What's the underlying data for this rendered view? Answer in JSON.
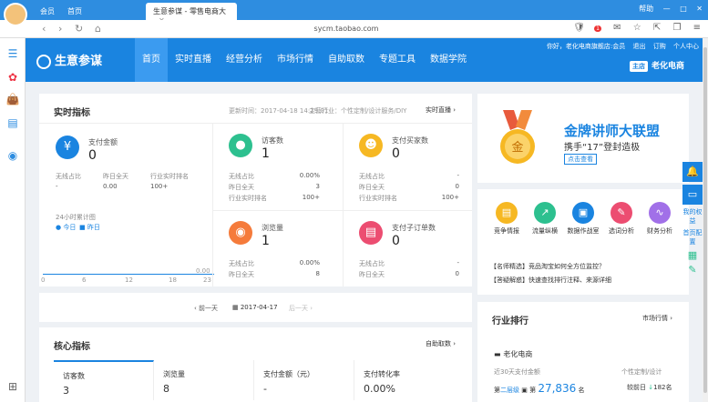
{
  "browser": {
    "tabs": [
      {
        "label": "会员"
      },
      {
        "label": "首页"
      },
      {
        "label": "生意参谋 - 零售电商大"
      }
    ],
    "right": [
      "帮助",
      "—",
      "□",
      "✕"
    ],
    "url": "sycm.taobao.com",
    "notif_count": "1"
  },
  "header": {
    "logo": "生意参谋",
    "menu": [
      "首页",
      "实时直播",
      "经营分析",
      "市场行情",
      "自助取数",
      "专题工具",
      "数据学院"
    ],
    "top_links": [
      "你好，老化电商旗舰店:会员",
      "退出",
      "订购",
      "个人中心"
    ],
    "store_tag": "主店",
    "store_name": "老化电商"
  },
  "realtime": {
    "title": "实时指标",
    "update_time": "更新时间：2017-04-18 14:29:01",
    "industry": "主营行业：个性定制/设计服务/DIY",
    "link": "实时直播",
    "metrics": [
      {
        "label": "支付金额",
        "value": "0",
        "subs": [
          [
            "无线占比",
            "-"
          ],
          [
            "昨日全天",
            "0.00"
          ],
          [
            "行业实时排名",
            "100+"
          ]
        ]
      },
      {
        "label": "访客数",
        "value": "1",
        "subs": [
          [
            "无线占比",
            "0.00%"
          ],
          [
            "昨日全天",
            "3"
          ],
          [
            "行业实时排名",
            "100+"
          ]
        ]
      },
      {
        "label": "支付买家数",
        "value": "0",
        "subs": [
          [
            "无线占比",
            "-"
          ],
          [
            "昨日全天",
            "0"
          ],
          [
            "行业实时排名",
            "100+"
          ]
        ]
      },
      {
        "label": "浏览量",
        "value": "1",
        "subs": [
          [
            "无线占比",
            "0.00%"
          ],
          [
            "昨日全天",
            "8"
          ]
        ]
      },
      {
        "label": "支付子订单数",
        "value": "0",
        "subs": [
          [
            "无线占比",
            "-"
          ],
          [
            "昨日全天",
            "0"
          ]
        ]
      }
    ],
    "chart_label": "24小时累计图",
    "legend_today": "今日",
    "legend_yesterday": "昨日",
    "x_ticks": [
      "0",
      "6",
      "12",
      "18",
      "23"
    ],
    "y_tick": "0.00",
    "prev_day": "前一天",
    "date": "2017-04-17",
    "next_day": "后一天"
  },
  "banner": {
    "title": "金牌讲师大联盟",
    "subtitle": "携手“17”登封造极",
    "button": "点击查看"
  },
  "tools": {
    "items": [
      "竞争情报",
      "流量纵横",
      "数据作战室",
      "选词分析",
      "财务分析"
    ],
    "news": [
      {
        "tag": "【名师精选】",
        "text": "竞品淘宝如何全方位监控？"
      },
      {
        "tag": "【答疑解惑】",
        "text": "快速查找排行注释、来源详细"
      }
    ]
  },
  "core": {
    "title": "核心指标",
    "link": "自助取数",
    "tabs": [
      {
        "label": "访客数",
        "value": "3"
      },
      {
        "label": "浏览量",
        "value": "8"
      },
      {
        "label": "支付金额（元）",
        "value": "-"
      },
      {
        "label": "支付转化率",
        "value": "0.00%"
      }
    ]
  },
  "ranking": {
    "title": "行业排行",
    "link": "市场行情",
    "store": "老化电商",
    "period": "近30天支付金额",
    "category": "个性定制/设计",
    "rank_prefix": "第",
    "rank": "二层级",
    "amount_prefix": "第",
    "amount": "27,836",
    "amount_unit": "名",
    "compare": "较前日",
    "compare_val": "182名"
  },
  "float": [
    "我的权益",
    "首页配置"
  ],
  "colors": {
    "brand": "#1a84e0",
    "yellow_icon": "#f6b823",
    "green_icon": "#2dc08f",
    "orange_icon": "#f57b3b",
    "pink_icon": "#ec4d71"
  }
}
